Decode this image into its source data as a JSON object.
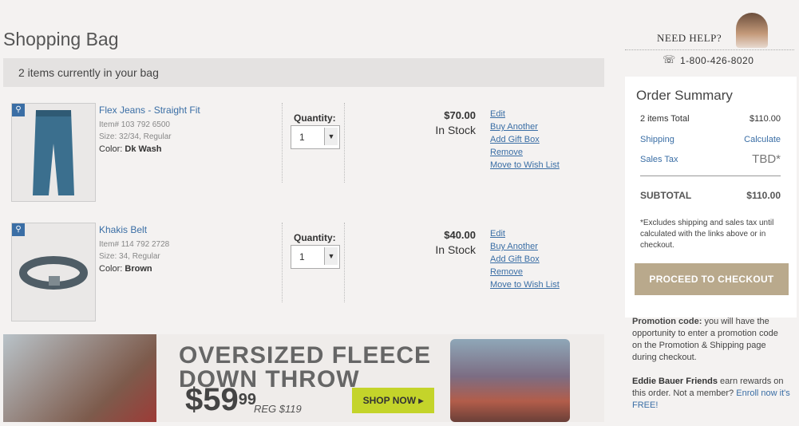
{
  "page": {
    "title": "Shopping Bag",
    "items_count_text": "2 items currently in your bag"
  },
  "items": [
    {
      "name": "Flex Jeans - Straight Fit",
      "sku": "Item# 103 792 6500",
      "size": "Size: 32/34, Regular",
      "color_label": "Color:",
      "color_value": "Dk Wash",
      "quantity_label": "Quantity:",
      "quantity": "1",
      "price": "$70.00",
      "stock": "In Stock",
      "actions": [
        "Edit",
        "Buy Another",
        "Add Gift Box",
        "Remove",
        "Move to Wish List"
      ]
    },
    {
      "name": "Khakis Belt",
      "sku": "Item# 114 792 2728",
      "size": "Size: 34, Regular",
      "color_label": "Color:",
      "color_value": "Brown",
      "quantity_label": "Quantity:",
      "quantity": "1",
      "price": "$40.00",
      "stock": "In Stock",
      "actions": [
        "Edit",
        "Buy Another",
        "Add Gift Box",
        "Remove",
        "Move to Wish List"
      ]
    }
  ],
  "banner": {
    "headline1": "OVERSIZED FLEECE",
    "headline2": "DOWN THROW",
    "price_dollars": "$59",
    "price_cents": "99",
    "reg_price": "REG $119",
    "cta": "SHOP NOW ▸"
  },
  "help": {
    "title": "NEED HELP?",
    "phone": "1-800-426-8020",
    "phone_icon": "☏"
  },
  "summary": {
    "title": "Order Summary",
    "rows": [
      {
        "label": "2 items Total",
        "value": "$110.00"
      },
      {
        "label": "Shipping",
        "value": "Calculate"
      },
      {
        "label": "Sales Tax",
        "value": "TBD*"
      }
    ],
    "subtotal_label": "SUBTOTAL",
    "subtotal_value": "$110.00",
    "note": "*Excludes shipping and sales tax until calculated with the links above or in checkout.",
    "checkout": "PROCEED TO CHECKOUT"
  },
  "promo": {
    "bold": "Promotion code:",
    "text": " you will have the opportunity to enter a promotion code on the Promotion & Shipping page during checkout."
  },
  "friends": {
    "bold": "Eddie Bauer Friends",
    "text": " earn rewards on this order. Not a member? ",
    "link": "Enroll now it's FREE!"
  }
}
